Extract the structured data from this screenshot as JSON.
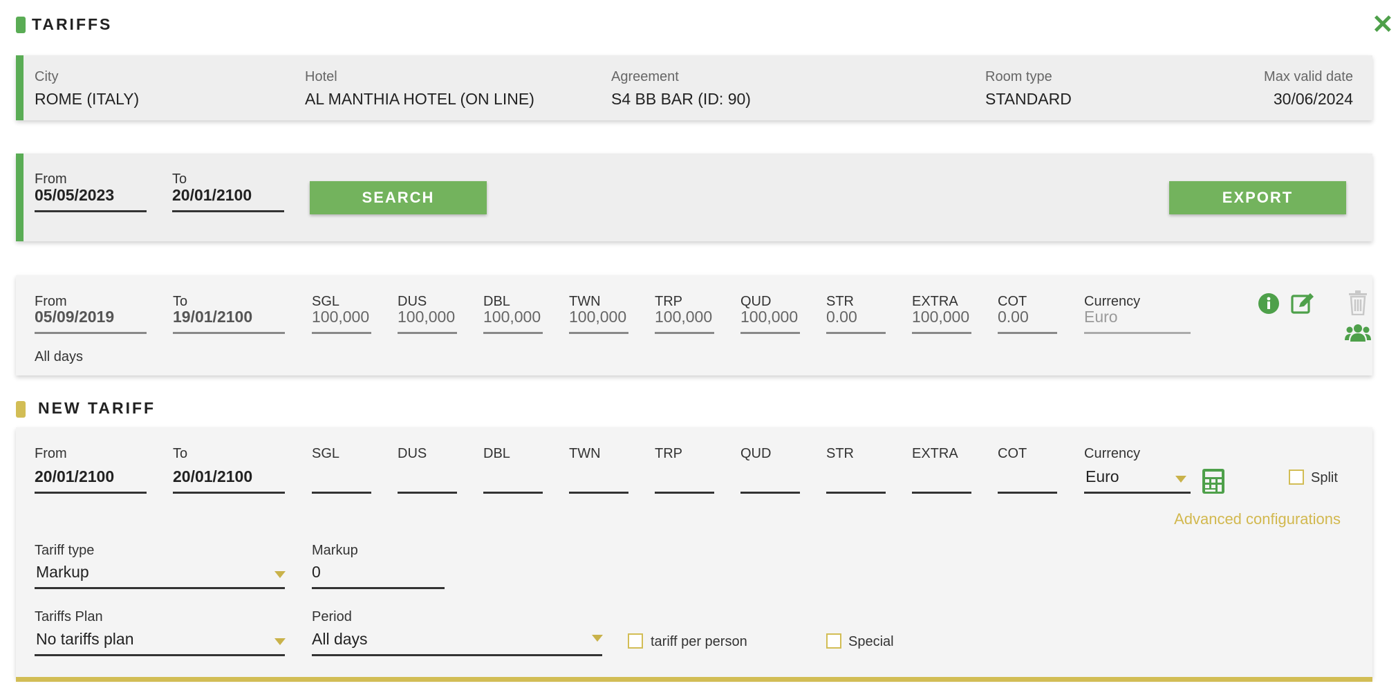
{
  "header": {
    "title": "TARIFFS",
    "close_icon": "close-icon"
  },
  "info": {
    "city_label": "City",
    "city": "ROME (ITALY)",
    "hotel_label": "Hotel",
    "hotel": "AL MANTHIA HOTEL (ON LINE)",
    "agreement_label": "Agreement",
    "agreement": "S4 BB BAR (ID: 90)",
    "room_type_label": "Room type",
    "room_type": "STANDARD",
    "max_date_label": "Max valid date",
    "max_date": "30/06/2024"
  },
  "search": {
    "from_label": "From",
    "from": "05/05/2023",
    "to_label": "To",
    "to": "20/01/2100",
    "search_button": "SEARCH",
    "export_button": "EXPORT"
  },
  "existing": {
    "from_label": "From",
    "from": "05/09/2019",
    "to_label": "To",
    "to": "19/01/2100",
    "cols": [
      {
        "label": "SGL",
        "value": "100,000"
      },
      {
        "label": "DUS",
        "value": "100,000"
      },
      {
        "label": "DBL",
        "value": "100,000"
      },
      {
        "label": "TWN",
        "value": "100,000"
      },
      {
        "label": "TRP",
        "value": "100,000"
      },
      {
        "label": "QUD",
        "value": "100,000"
      },
      {
        "label": "STR",
        "value": "0.00"
      },
      {
        "label": "EXTRA",
        "value": "100,000"
      },
      {
        "label": "COT",
        "value": "0.00"
      }
    ],
    "currency_label": "Currency",
    "currency": "Euro",
    "period": "All days"
  },
  "new_tariff": {
    "title": "NEW TARIFF",
    "from_label": "From",
    "from": "20/01/2100",
    "to_label": "To",
    "to": "20/01/2100",
    "cols": [
      "SGL",
      "DUS",
      "DBL",
      "TWN",
      "TRP",
      "QUD",
      "STR",
      "EXTRA",
      "COT"
    ],
    "currency_label": "Currency",
    "currency": "Euro",
    "split_label": "Split",
    "advanced": "Advanced configurations",
    "tariff_type_label": "Tariff type",
    "tariff_type": "Markup",
    "markup_label": "Markup",
    "markup": "0",
    "plan_label": "Tariffs Plan",
    "plan": "No tariffs plan",
    "period_label": "Period",
    "period": "All days",
    "per_person_label": "tariff per person",
    "special_label": "Special"
  },
  "colors": {
    "green": "#5aac55",
    "button_green": "#73b35d",
    "gold": "#d2bd55"
  }
}
